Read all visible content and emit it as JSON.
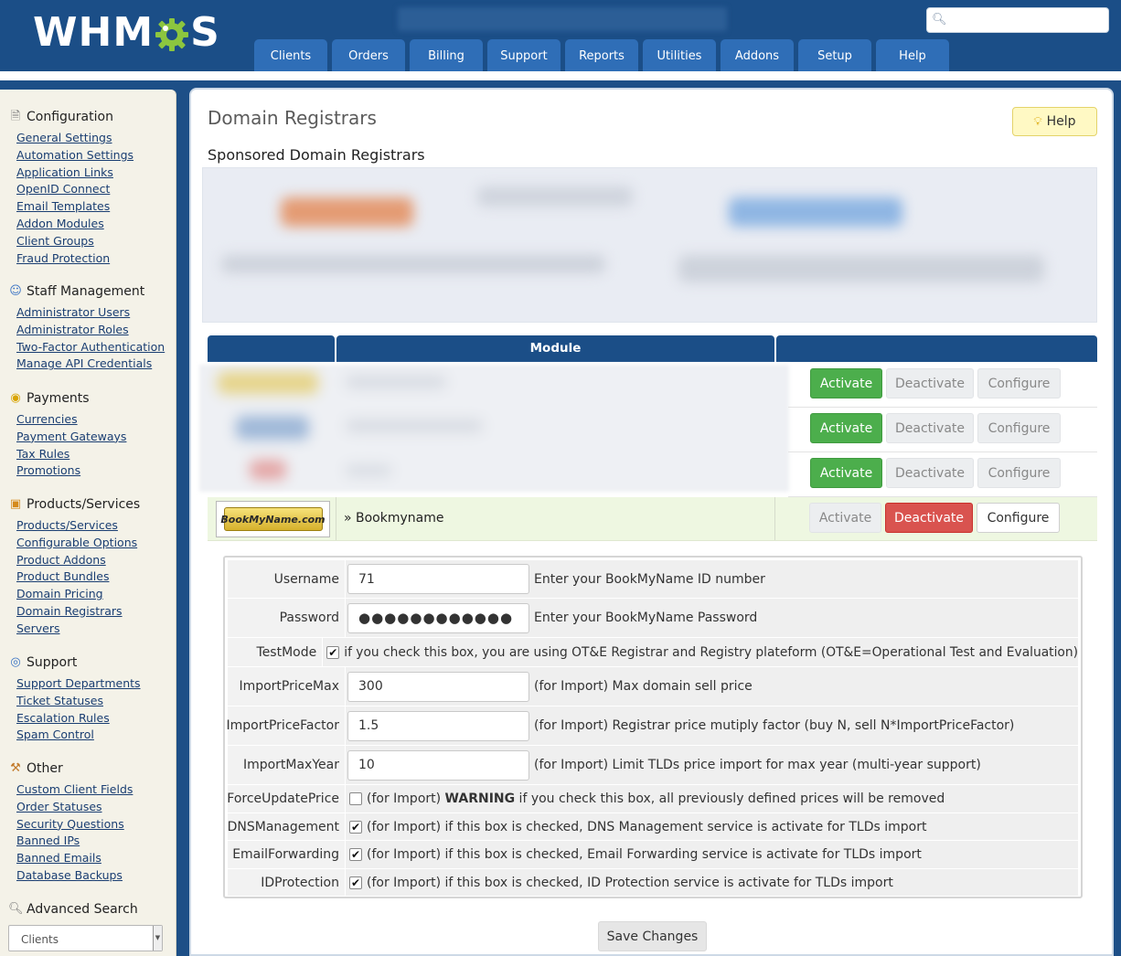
{
  "header": {
    "logo_text_left": "WHM",
    "logo_text_right": "S",
    "search": {
      "placeholder": "",
      "value": ""
    },
    "nav_tabs": [
      "Clients",
      "Orders",
      "Billing",
      "Support",
      "Reports",
      "Utilities",
      "Addons",
      "Setup",
      "Help"
    ]
  },
  "sidebar": {
    "sections": [
      {
        "title": "Configuration",
        "icon": "document-gear-icon",
        "links": [
          "General Settings",
          "Automation Settings",
          "Application Links",
          "OpenID Connect",
          "Email Templates",
          "Addon Modules",
          "Client Groups",
          "Fraud Protection"
        ]
      },
      {
        "title": "Staff Management",
        "icon": "user-icon",
        "links": [
          "Administrator Users",
          "Administrator Roles",
          "Two-Factor Authentication",
          "Manage API Credentials"
        ]
      },
      {
        "title": "Payments",
        "icon": "coins-icon",
        "links": [
          "Currencies",
          "Payment Gateways",
          "Tax Rules",
          "Promotions"
        ]
      },
      {
        "title": "Products/Services",
        "icon": "box-icon",
        "links": [
          "Products/Services",
          "Configurable Options",
          "Product Addons",
          "Product Bundles",
          "Domain Pricing",
          "Domain Registrars",
          "Servers"
        ]
      },
      {
        "title": "Support",
        "icon": "lifebuoy-icon",
        "links": [
          "Support Departments",
          "Ticket Statuses",
          "Escalation Rules",
          "Spam Control"
        ]
      },
      {
        "title": "Other",
        "icon": "wrench-icon",
        "links": [
          "Custom Client Fields",
          "Order Statuses",
          "Security Questions",
          "Banned IPs",
          "Banned Emails",
          "Database Backups"
        ]
      }
    ],
    "advanced_search": {
      "title": "Advanced Search",
      "select_value": "Clients"
    }
  },
  "main": {
    "page_title": "Domain Registrars",
    "help_label": "Help",
    "sponsored_title": "Sponsored Domain Registrars",
    "table": {
      "headers": [
        "",
        "Module",
        ""
      ],
      "activate_label": "Activate",
      "deactivate_label": "Deactivate",
      "configure_label": "Configure",
      "active_module": {
        "logo_text": "BookMyName.com",
        "name": "» Bookmyname"
      }
    },
    "config": {
      "rows": [
        {
          "label": "Username",
          "type": "text",
          "value": "71",
          "desc": "Enter your BookMyName ID number"
        },
        {
          "label": "Password",
          "type": "password",
          "value": "●●●●●●●●●●●●",
          "desc": "Enter your BookMyName Password"
        },
        {
          "label": "TestMode",
          "type": "checkbox",
          "checked": true,
          "desc": "if you check this box, you are using OT&E Registrar and Registry plateform (OT&E=Operational Test and Evaluation)"
        },
        {
          "label": "ImportPriceMax",
          "type": "text",
          "value": "300",
          "desc": "(for Import) Max domain sell price"
        },
        {
          "label": "ImportPriceFactor",
          "type": "text",
          "value": "1.5",
          "desc": "(for Import) Registrar price mutiply factor (buy N, sell N*ImportPriceFactor)"
        },
        {
          "label": "ImportMaxYear",
          "type": "text",
          "value": "10",
          "desc": "(for Import) Limit TLDs price import for max year (multi-year support)"
        },
        {
          "label": "ForceUpdatePrice",
          "type": "checkbox",
          "checked": false,
          "desc_prefix": "(for Import) ",
          "desc_bold": "WARNING",
          "desc": " if you check this box, all previously defined prices will be removed"
        },
        {
          "label": "DNSManagement",
          "type": "checkbox",
          "checked": true,
          "desc": "(for Import) if this box is checked, DNS Management service is activate for TLDs import"
        },
        {
          "label": "EmailForwarding",
          "type": "checkbox",
          "checked": true,
          "desc": "(for Import) if this box is checked, Email Forwarding service is activate for TLDs import"
        },
        {
          "label": "IDProtection",
          "type": "checkbox",
          "checked": true,
          "desc": "(for Import) if this box is checked, ID Protection service is activate for TLDs import"
        }
      ],
      "save_label": "Save Changes"
    }
  },
  "colors": {
    "brand": "#1b4e87",
    "tab": "#2f6eb7",
    "activate": "#4cae4c",
    "deactivate": "#d9534f",
    "logo_gear": "#8cc63f"
  }
}
